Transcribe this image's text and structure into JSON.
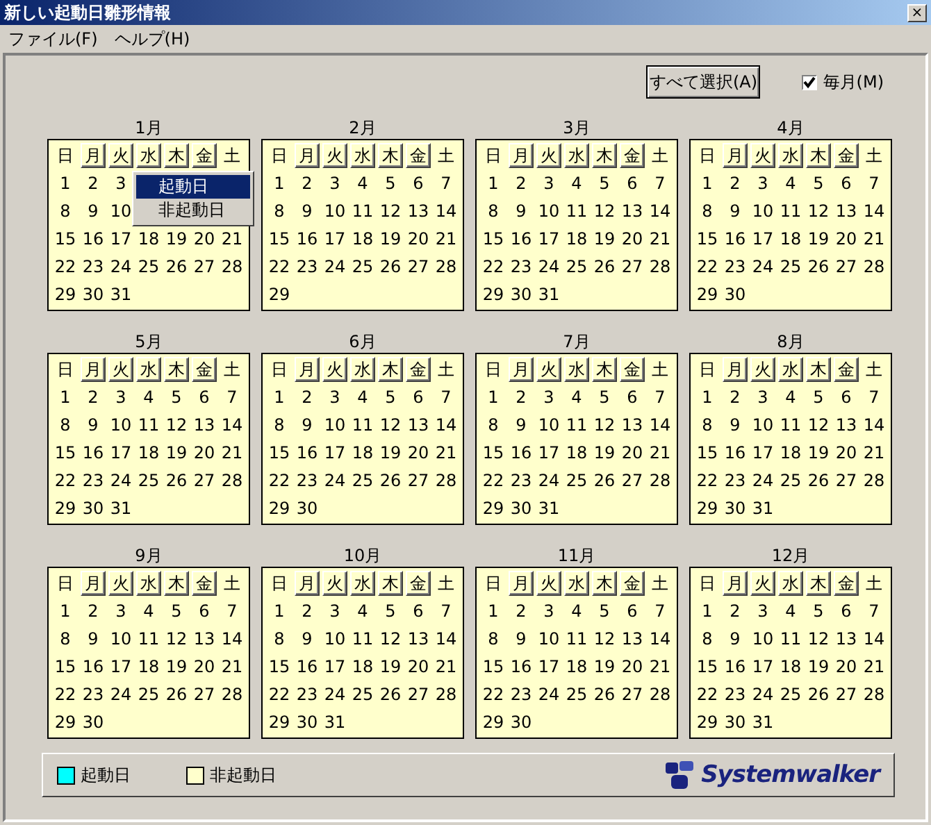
{
  "window": {
    "title": "新しい起動日雛形情報",
    "close": "×"
  },
  "menu": [
    "ファイル(F)",
    "ヘルプ(H)"
  ],
  "select_all_button": "すべて選択(A)",
  "monthly_checkbox": {
    "label": "毎月(M)",
    "checked": true
  },
  "months": [
    {
      "title": "1月",
      "weekdays": [
        {
          "label": "日",
          "kind": "plain"
        },
        {
          "label": "月",
          "kind": "button"
        },
        {
          "label": "火",
          "kind": "button"
        },
        {
          "label": "水",
          "kind": "button"
        },
        {
          "label": "木",
          "kind": "button"
        },
        {
          "label": "金",
          "kind": "button"
        },
        {
          "label": "土",
          "kind": "plain"
        }
      ],
      "weeks": [
        [
          "1",
          "2",
          "3"
        ],
        [
          "8",
          "9",
          "10"
        ],
        [
          "15",
          "16",
          "17",
          "18",
          "19",
          "20",
          "21"
        ],
        [
          "22",
          "23",
          "24",
          "25",
          "26",
          "27",
          "28"
        ],
        [
          "29",
          "30",
          "31"
        ]
      ],
      "context_menu": [
        {
          "label": "起動日",
          "selected": true
        },
        {
          "label": "非起動日",
          "selected": false
        }
      ]
    },
    {
      "title": "2月",
      "weekdays": [
        {
          "label": "日",
          "kind": "plain"
        },
        {
          "label": "月",
          "kind": "button"
        },
        {
          "label": "火",
          "kind": "button"
        },
        {
          "label": "水",
          "kind": "button"
        },
        {
          "label": "木",
          "kind": "button"
        },
        {
          "label": "金",
          "kind": "button"
        },
        {
          "label": "土",
          "kind": "plain"
        }
      ],
      "weeks": [
        [
          "1",
          "2",
          "3",
          "4",
          "5",
          "6",
          "7"
        ],
        [
          "8",
          "9",
          "10",
          "11",
          "12",
          "13",
          "14"
        ],
        [
          "15",
          "16",
          "17",
          "18",
          "19",
          "20",
          "21"
        ],
        [
          "22",
          "23",
          "24",
          "25",
          "26",
          "27",
          "28"
        ],
        [
          "29"
        ]
      ]
    },
    {
      "title": "3月",
      "weekdays": [
        {
          "label": "日",
          "kind": "plain"
        },
        {
          "label": "月",
          "kind": "button"
        },
        {
          "label": "火",
          "kind": "button"
        },
        {
          "label": "水",
          "kind": "button"
        },
        {
          "label": "木",
          "kind": "button"
        },
        {
          "label": "金",
          "kind": "button"
        },
        {
          "label": "土",
          "kind": "plain"
        }
      ],
      "weeks": [
        [
          "1",
          "2",
          "3",
          "4",
          "5",
          "6",
          "7"
        ],
        [
          "8",
          "9",
          "10",
          "11",
          "12",
          "13",
          "14"
        ],
        [
          "15",
          "16",
          "17",
          "18",
          "19",
          "20",
          "21"
        ],
        [
          "22",
          "23",
          "24",
          "25",
          "26",
          "27",
          "28"
        ],
        [
          "29",
          "30",
          "31"
        ]
      ]
    },
    {
      "title": "4月",
      "weekdays": [
        {
          "label": "日",
          "kind": "plain"
        },
        {
          "label": "月",
          "kind": "button"
        },
        {
          "label": "火",
          "kind": "button"
        },
        {
          "label": "水",
          "kind": "button"
        },
        {
          "label": "木",
          "kind": "button"
        },
        {
          "label": "金",
          "kind": "button"
        },
        {
          "label": "土",
          "kind": "plain"
        }
      ],
      "weeks": [
        [
          "1",
          "2",
          "3",
          "4",
          "5",
          "6",
          "7"
        ],
        [
          "8",
          "9",
          "10",
          "11",
          "12",
          "13",
          "14"
        ],
        [
          "15",
          "16",
          "17",
          "18",
          "19",
          "20",
          "21"
        ],
        [
          "22",
          "23",
          "24",
          "25",
          "26",
          "27",
          "28"
        ],
        [
          "29",
          "30"
        ]
      ]
    },
    {
      "title": "5月",
      "weekdays": [
        {
          "label": "日",
          "kind": "plain"
        },
        {
          "label": "月",
          "kind": "button"
        },
        {
          "label": "火",
          "kind": "button"
        },
        {
          "label": "水",
          "kind": "button"
        },
        {
          "label": "木",
          "kind": "button"
        },
        {
          "label": "金",
          "kind": "button"
        },
        {
          "label": "土",
          "kind": "plain"
        }
      ],
      "weeks": [
        [
          "1",
          "2",
          "3",
          "4",
          "5",
          "6",
          "7"
        ],
        [
          "8",
          "9",
          "10",
          "11",
          "12",
          "13",
          "14"
        ],
        [
          "15",
          "16",
          "17",
          "18",
          "19",
          "20",
          "21"
        ],
        [
          "22",
          "23",
          "24",
          "25",
          "26",
          "27",
          "28"
        ],
        [
          "29",
          "30",
          "31"
        ]
      ]
    },
    {
      "title": "6月",
      "weekdays": [
        {
          "label": "日",
          "kind": "plain"
        },
        {
          "label": "月",
          "kind": "button"
        },
        {
          "label": "火",
          "kind": "button"
        },
        {
          "label": "水",
          "kind": "button"
        },
        {
          "label": "木",
          "kind": "button"
        },
        {
          "label": "金",
          "kind": "button"
        },
        {
          "label": "土",
          "kind": "plain"
        }
      ],
      "weeks": [
        [
          "1",
          "2",
          "3",
          "4",
          "5",
          "6",
          "7"
        ],
        [
          "8",
          "9",
          "10",
          "11",
          "12",
          "13",
          "14"
        ],
        [
          "15",
          "16",
          "17",
          "18",
          "19",
          "20",
          "21"
        ],
        [
          "22",
          "23",
          "24",
          "25",
          "26",
          "27",
          "28"
        ],
        [
          "29",
          "30"
        ]
      ]
    },
    {
      "title": "7月",
      "weekdays": [
        {
          "label": "日",
          "kind": "plain"
        },
        {
          "label": "月",
          "kind": "button"
        },
        {
          "label": "火",
          "kind": "button"
        },
        {
          "label": "水",
          "kind": "button"
        },
        {
          "label": "木",
          "kind": "button"
        },
        {
          "label": "金",
          "kind": "button"
        },
        {
          "label": "土",
          "kind": "plain"
        }
      ],
      "weeks": [
        [
          "1",
          "2",
          "3",
          "4",
          "5",
          "6",
          "7"
        ],
        [
          "8",
          "9",
          "10",
          "11",
          "12",
          "13",
          "14"
        ],
        [
          "15",
          "16",
          "17",
          "18",
          "19",
          "20",
          "21"
        ],
        [
          "22",
          "23",
          "24",
          "25",
          "26",
          "27",
          "28"
        ],
        [
          "29",
          "30",
          "31"
        ]
      ]
    },
    {
      "title": "8月",
      "weekdays": [
        {
          "label": "日",
          "kind": "plain"
        },
        {
          "label": "月",
          "kind": "button"
        },
        {
          "label": "火",
          "kind": "button"
        },
        {
          "label": "水",
          "kind": "button"
        },
        {
          "label": "木",
          "kind": "button"
        },
        {
          "label": "金",
          "kind": "button"
        },
        {
          "label": "土",
          "kind": "plain"
        }
      ],
      "weeks": [
        [
          "1",
          "2",
          "3",
          "4",
          "5",
          "6",
          "7"
        ],
        [
          "8",
          "9",
          "10",
          "11",
          "12",
          "13",
          "14"
        ],
        [
          "15",
          "16",
          "17",
          "18",
          "19",
          "20",
          "21"
        ],
        [
          "22",
          "23",
          "24",
          "25",
          "26",
          "27",
          "28"
        ],
        [
          "29",
          "30",
          "31"
        ]
      ]
    },
    {
      "title": "9月",
      "weekdays": [
        {
          "label": "日",
          "kind": "plain"
        },
        {
          "label": "月",
          "kind": "button"
        },
        {
          "label": "火",
          "kind": "button"
        },
        {
          "label": "水",
          "kind": "button"
        },
        {
          "label": "木",
          "kind": "button"
        },
        {
          "label": "金",
          "kind": "button"
        },
        {
          "label": "土",
          "kind": "plain"
        }
      ],
      "weeks": [
        [
          "1",
          "2",
          "3",
          "4",
          "5",
          "6",
          "7"
        ],
        [
          "8",
          "9",
          "10",
          "11",
          "12",
          "13",
          "14"
        ],
        [
          "15",
          "16",
          "17",
          "18",
          "19",
          "20",
          "21"
        ],
        [
          "22",
          "23",
          "24",
          "25",
          "26",
          "27",
          "28"
        ],
        [
          "29",
          "30"
        ]
      ]
    },
    {
      "title": "10月",
      "weekdays": [
        {
          "label": "日",
          "kind": "plain"
        },
        {
          "label": "月",
          "kind": "button"
        },
        {
          "label": "火",
          "kind": "button"
        },
        {
          "label": "水",
          "kind": "button"
        },
        {
          "label": "木",
          "kind": "button"
        },
        {
          "label": "金",
          "kind": "button"
        },
        {
          "label": "土",
          "kind": "plain"
        }
      ],
      "weeks": [
        [
          "1",
          "2",
          "3",
          "4",
          "5",
          "6",
          "7"
        ],
        [
          "8",
          "9",
          "10",
          "11",
          "12",
          "13",
          "14"
        ],
        [
          "15",
          "16",
          "17",
          "18",
          "19",
          "20",
          "21"
        ],
        [
          "22",
          "23",
          "24",
          "25",
          "26",
          "27",
          "28"
        ],
        [
          "29",
          "30",
          "31"
        ]
      ]
    },
    {
      "title": "11月",
      "weekdays": [
        {
          "label": "日",
          "kind": "plain"
        },
        {
          "label": "月",
          "kind": "button"
        },
        {
          "label": "火",
          "kind": "button"
        },
        {
          "label": "水",
          "kind": "button"
        },
        {
          "label": "木",
          "kind": "button"
        },
        {
          "label": "金",
          "kind": "button"
        },
        {
          "label": "土",
          "kind": "plain"
        }
      ],
      "weeks": [
        [
          "1",
          "2",
          "3",
          "4",
          "5",
          "6",
          "7"
        ],
        [
          "8",
          "9",
          "10",
          "11",
          "12",
          "13",
          "14"
        ],
        [
          "15",
          "16",
          "17",
          "18",
          "19",
          "20",
          "21"
        ],
        [
          "22",
          "23",
          "24",
          "25",
          "26",
          "27",
          "28"
        ],
        [
          "29",
          "30"
        ]
      ]
    },
    {
      "title": "12月",
      "weekdays": [
        {
          "label": "日",
          "kind": "plain"
        },
        {
          "label": "月",
          "kind": "button"
        },
        {
          "label": "火",
          "kind": "button"
        },
        {
          "label": "水",
          "kind": "button"
        },
        {
          "label": "木",
          "kind": "button"
        },
        {
          "label": "金",
          "kind": "button"
        },
        {
          "label": "土",
          "kind": "plain"
        }
      ],
      "weeks": [
        [
          "1",
          "2",
          "3",
          "4",
          "5",
          "6",
          "7"
        ],
        [
          "8",
          "9",
          "10",
          "11",
          "12",
          "13",
          "14"
        ],
        [
          "15",
          "16",
          "17",
          "18",
          "19",
          "20",
          "21"
        ],
        [
          "22",
          "23",
          "24",
          "25",
          "26",
          "27",
          "28"
        ],
        [
          "29",
          "30",
          "31"
        ]
      ]
    }
  ],
  "legend": [
    {
      "label": "起動日",
      "color": "#00ffff"
    },
    {
      "label": "非起動日",
      "color": "#ffffcc"
    }
  ],
  "logo": "Systemwalker"
}
